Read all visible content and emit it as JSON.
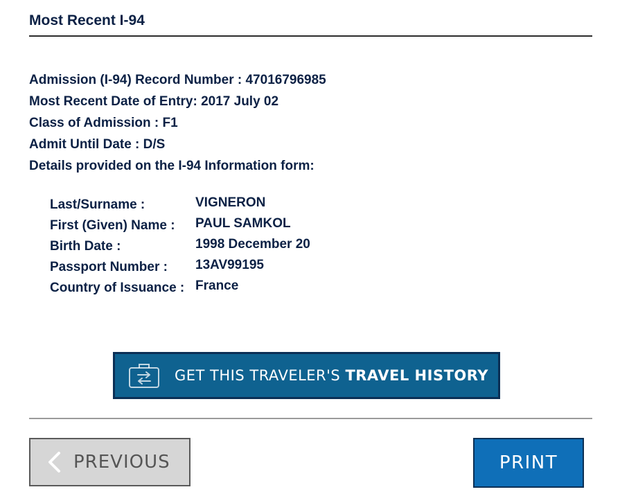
{
  "section": {
    "title": "Most Recent I-94"
  },
  "summary": {
    "record_number": "Admission (I-94) Record Number : 47016796985",
    "entry_date": "Most Recent Date of Entry: 2017 July 02",
    "class_of_admission": "Class of Admission : F1",
    "admit_until": "Admit Until Date : D/S",
    "details_intro": "Details provided on the I-94 Information form:"
  },
  "details": {
    "rows": [
      {
        "label": "Last/Surname :",
        "value": "VIGNERON"
      },
      {
        "label": "First (Given) Name :",
        "value": "PAUL SAMKOL"
      },
      {
        "label": "Birth Date :",
        "value": "1998 December 20"
      },
      {
        "label": "Passport Number :",
        "value": "13AV99195"
      },
      {
        "label": "Country of Issuance :",
        "value": "France"
      }
    ]
  },
  "travel_history_button": {
    "label_prefix": "GET THIS TRAVELER'S ",
    "label_bold": "TRAVEL HISTORY",
    "icon": "suitcase-transfer-icon"
  },
  "navigation": {
    "previous_label": "PREVIOUS",
    "previous_icon": "chevron-left-icon",
    "print_label": "PRINT"
  },
  "colors": {
    "text": "#0c2145",
    "history_button": "#0f6290",
    "print_button": "#0f6fb8",
    "previous_button": "#d6d6d6"
  }
}
